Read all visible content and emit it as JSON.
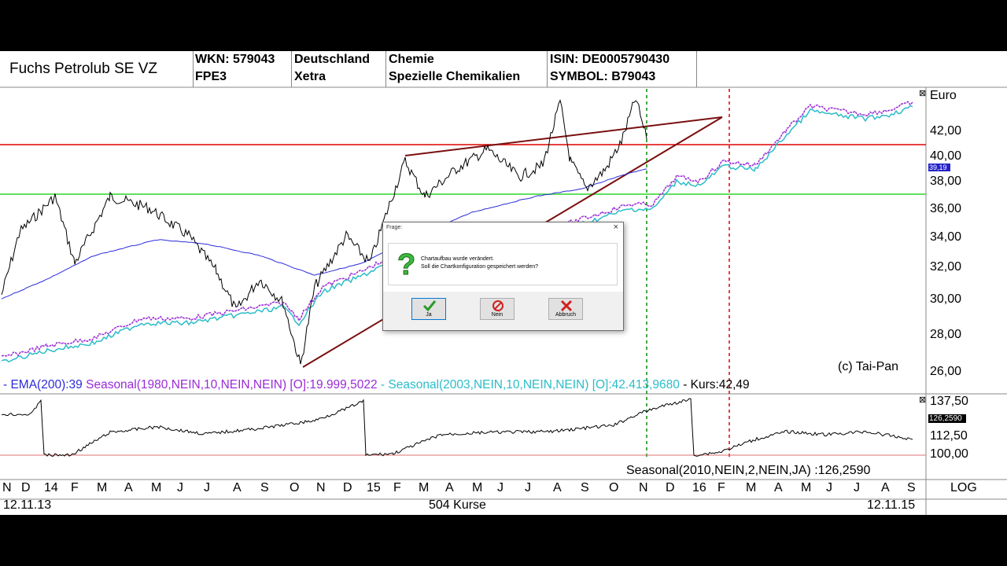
{
  "header": {
    "stock_name": "Fuchs Petrolub SE VZ",
    "wkn": "WKN: 579043",
    "wkn_sub": "FPE3",
    "country": "Deutschland",
    "exchange": "Xetra",
    "sector": "Chemie",
    "sector_sub": "Spezielle Chemikalien",
    "isin": "ISIN: DE0005790430",
    "symbol": "SYMBOL: B79043"
  },
  "price_axis": {
    "unit": "Euro",
    "labels": [
      "42,00",
      "40,00",
      "38,00",
      "36,00",
      "34,00",
      "32,00",
      "30,00",
      "28,00",
      "26,00"
    ],
    "current_marker": "39,19"
  },
  "indicator_axis": {
    "labels": [
      "137,50",
      "112,50",
      "100,00"
    ],
    "current_marker": "126,2590"
  },
  "copyright": "(c) Tai-Pan",
  "legend": {
    "ema": "- EMA(200):39",
    "seasonal1": "Seasonal(1980,NEIN,10,NEIN,NEIN) [O]:19.999,5022",
    "sep": "-",
    "seasonal2": "Seasonal(2003,NEIN,10,NEIN,NEIN) [O]:42.413,9680",
    "kurs": "- Kurs:42,49"
  },
  "indicator_legend": "Seasonal(2010,NEIN,2,NEIN,JA) :126,2590",
  "months": [
    "N",
    "D",
    "14",
    "F",
    "M",
    "A",
    "M",
    "J",
    "J",
    "A",
    "S",
    "O",
    "N",
    "D",
    "15",
    "F",
    "M",
    "A",
    "M",
    "J",
    "J",
    "A",
    "S",
    "O",
    "N",
    "D",
    "16",
    "F",
    "M",
    "A",
    "M",
    "J",
    "J",
    "A",
    "S"
  ],
  "footer": {
    "start_date": "12.11.13",
    "count": "504 Kurse",
    "end_date": "12.11.15",
    "scale_mode": "LOG"
  },
  "dialog": {
    "title": "Frage:",
    "close": "×",
    "line1": "Chartaufbau wurde verändert.",
    "line2": "Soll die Chartkonfiguration gespeichert werden?",
    "yes": "Ja",
    "no": "Nein",
    "cancel": "Abbruch"
  },
  "colors": {
    "price": "#000000",
    "ema": "#2b2bdb",
    "seasonal1": "#9a2bd6",
    "seasonal2": "#2bbcc8",
    "resistance": "#e00000",
    "support": "#2bd62b",
    "trendline": "#7a0f0f",
    "marker_today": "#0a8a0a",
    "marker_future": "#e00000"
  }
}
